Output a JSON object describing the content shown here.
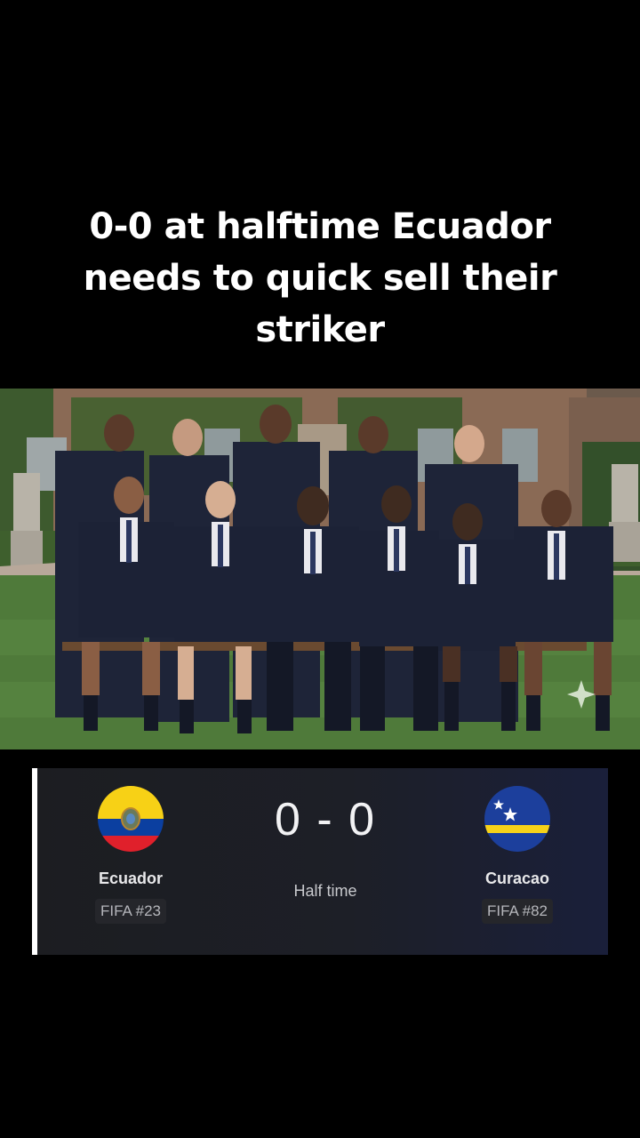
{
  "caption": "0-0 at halftime Ecuador needs to quick sell their striker",
  "photo": {
    "icon": "sparkle-icon"
  },
  "scorecard": {
    "home": {
      "name": "Ecuador",
      "rank": "FIFA #23",
      "flag_colors": [
        "#f7d116",
        "#0b3fa0",
        "#e0202b"
      ]
    },
    "away": {
      "name": "Curacao",
      "rank": "FIFA #82",
      "flag_colors": [
        "#1c3f9c",
        "#f6d21a",
        "#ffffff"
      ]
    },
    "score": "0 - 0",
    "status": "Half time"
  }
}
